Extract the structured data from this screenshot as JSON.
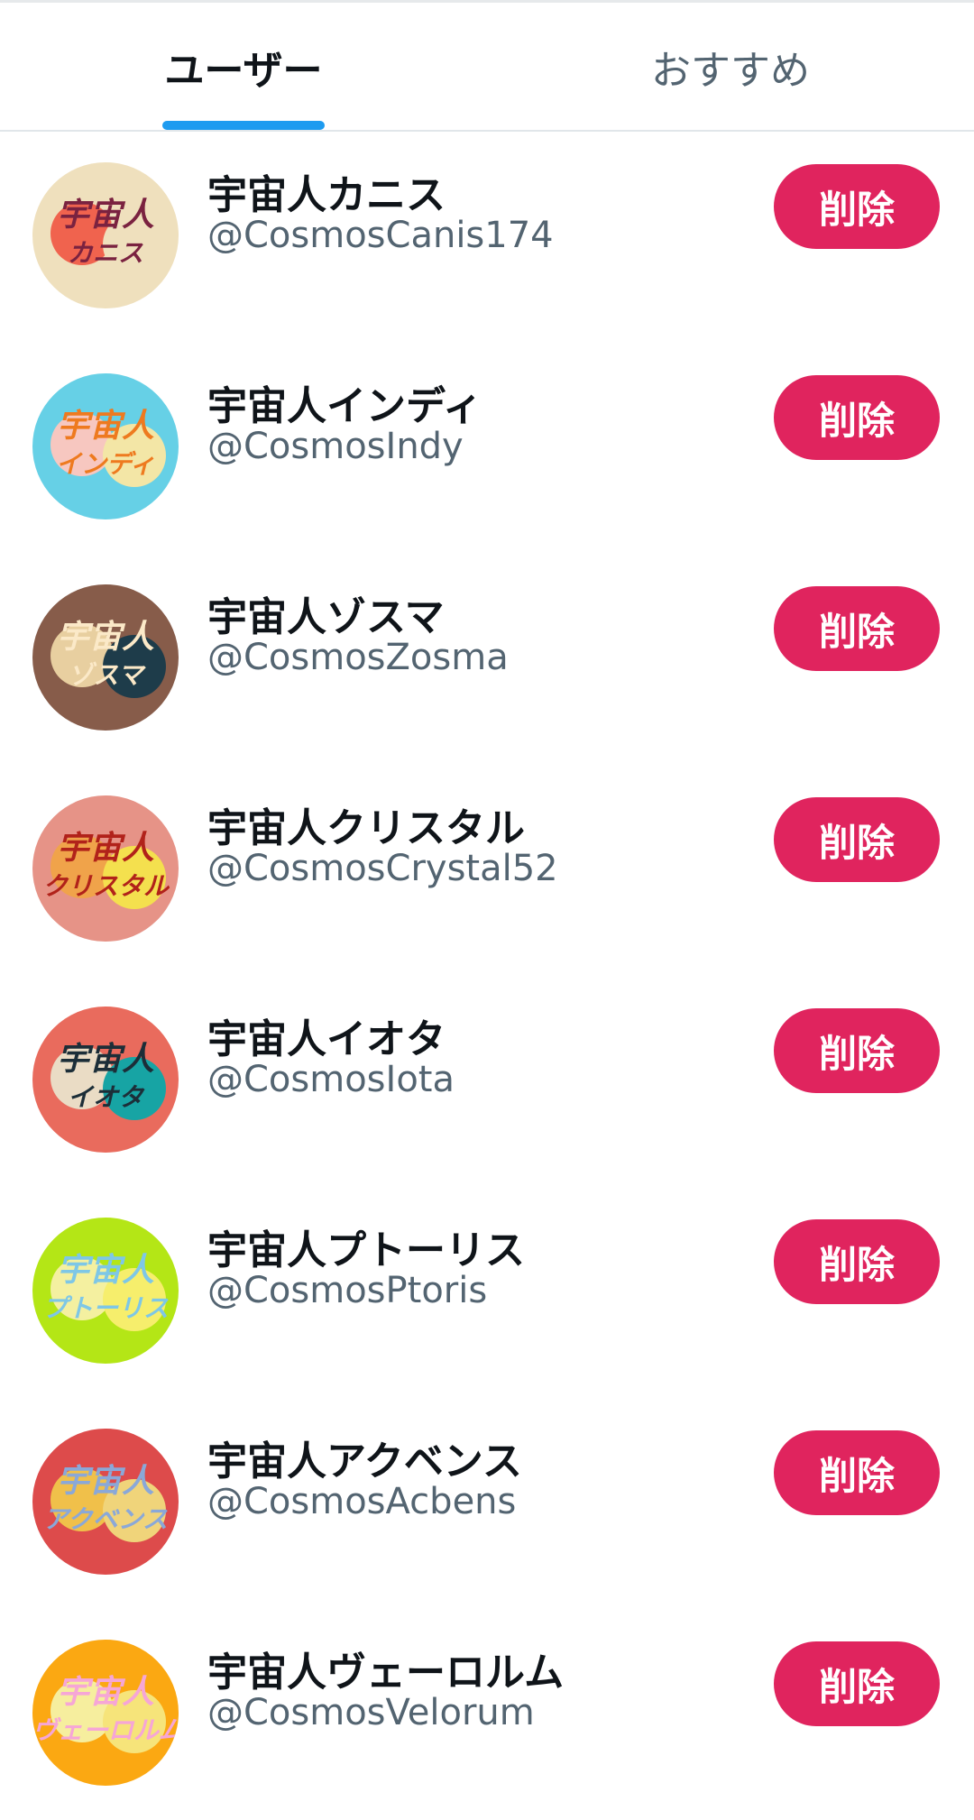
{
  "tabs": {
    "users_label": "ユーザー",
    "recommended_label": "おすすめ",
    "active": "users"
  },
  "accent_color": "#1d9bf0",
  "delete_color": "#e0245e",
  "users": [
    {
      "name": "宇宙人カニス",
      "handle": "@CosmosCanis174",
      "delete_label": "削除",
      "avatar_text": [
        "宇宙人",
        "カニス"
      ],
      "avatar_bg": "#efe0bd",
      "avatar_blob1": "#f0634e",
      "avatar_blob2": "#efe0bd",
      "avatar_text_color": "#7a2240"
    },
    {
      "name": "宇宙人インディ",
      "handle": "@CosmosIndy",
      "delete_label": "削除",
      "avatar_text": [
        "宇宙人",
        "インディ"
      ],
      "avatar_bg": "#66d0e6",
      "avatar_blob1": "#f7c7c0",
      "avatar_blob2": "#f3e6a6",
      "avatar_text_color": "#ee7a1f"
    },
    {
      "name": "宇宙人ゾスマ",
      "handle": "@CosmosZosma",
      "delete_label": "削除",
      "avatar_text": [
        "宇宙人",
        "ゾスマ"
      ],
      "avatar_bg": "#875c4a",
      "avatar_blob1": "#e8cfa0",
      "avatar_blob2": "#1e3c4a",
      "avatar_text_color": "#fbe9c8"
    },
    {
      "name": "宇宙人クリスタル",
      "handle": "@CosmosCrystal52",
      "delete_label": "削除",
      "avatar_text": [
        "宇宙人",
        "クリスタル"
      ],
      "avatar_bg": "#e69387",
      "avatar_blob1": "#f0a34a",
      "avatar_blob2": "#f4e04e",
      "avatar_text_color": "#b1221a"
    },
    {
      "name": "宇宙人イオタ",
      "handle": "@CosmosIota",
      "delete_label": "削除",
      "avatar_text": [
        "宇宙人",
        "イオタ"
      ],
      "avatar_bg": "#e96b5d",
      "avatar_blob1": "#eadcc5",
      "avatar_blob2": "#17a4a4",
      "avatar_text_color": "#1c2e38"
    },
    {
      "name": "宇宙人プトーリス",
      "handle": "@CosmosPtoris",
      "delete_label": "削除",
      "avatar_text": [
        "宇宙人",
        "プトーリス"
      ],
      "avatar_bg": "#b4e616",
      "avatar_blob1": "#f4f0a0",
      "avatar_blob2": "#f6ee6c",
      "avatar_text_color": "#7ec7e6"
    },
    {
      "name": "宇宙人アクベンス",
      "handle": "@CosmosAcbens",
      "delete_label": "削除",
      "avatar_text": [
        "宇宙人",
        "アクベンス"
      ],
      "avatar_bg": "#dd4b4b",
      "avatar_blob1": "#f0c04a",
      "avatar_blob2": "#f0d47a",
      "avatar_text_color": "#8aa8d8"
    },
    {
      "name": "宇宙人ヴェーロルム",
      "handle": "@CosmosVelorum",
      "delete_label": "削除",
      "avatar_text": [
        "宇宙人",
        "ヴェーロルム"
      ],
      "avatar_bg": "#fba812",
      "avatar_blob1": "#f6ee9e",
      "avatar_blob2": "#f6e47a",
      "avatar_text_color": "#f6a6d6"
    }
  ]
}
